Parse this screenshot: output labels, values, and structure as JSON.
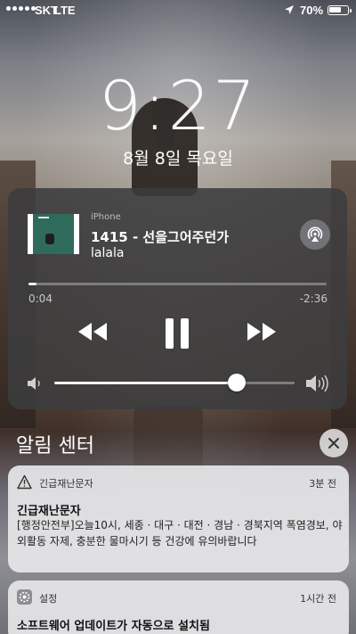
{
  "status_bar": {
    "carrier": "SKT",
    "network": "LTE",
    "battery_percent_text": "70%",
    "battery_level": 0.7,
    "icons": [
      "signal-dots-icon",
      "location-arrow-icon",
      "battery-icon"
    ]
  },
  "lock_screen": {
    "time": "9:27",
    "date": "8월 8일 목요일"
  },
  "now_playing": {
    "source": "iPhone",
    "title": "1415 - 선을그어주던가",
    "artist": "lalala",
    "elapsed": "0:04",
    "remaining": "-2:36",
    "progress": 0.027,
    "volume": 0.76,
    "controls": [
      "rewind-icon",
      "pause-icon",
      "fast-forward-icon",
      "airplay-icon"
    ]
  },
  "notification_center": {
    "title": "알림 센터",
    "close_icon": "close-icon",
    "notifications": [
      {
        "app": "긴급재난문자",
        "icon": "warning-icon",
        "time": "3분 전",
        "title": "긴급재난문자",
        "body": "[행정안전부]오늘10시, 세종 · 대구 · 대전 · 경남 · 경북지역  폭염경보, 야외활동 자제, 충분한 물마시기 등 건강에 유의바랍니다"
      },
      {
        "app": "설정",
        "icon": "settings-gear-icon",
        "time": "1시간 전",
        "title": "소프트웨어 업데이트가 자동으로 설치됨"
      }
    ]
  },
  "colors": {
    "widget_bg": "#3c3c3e",
    "notification_bg": "#e6e6e8",
    "text_white": "#ffffff"
  }
}
